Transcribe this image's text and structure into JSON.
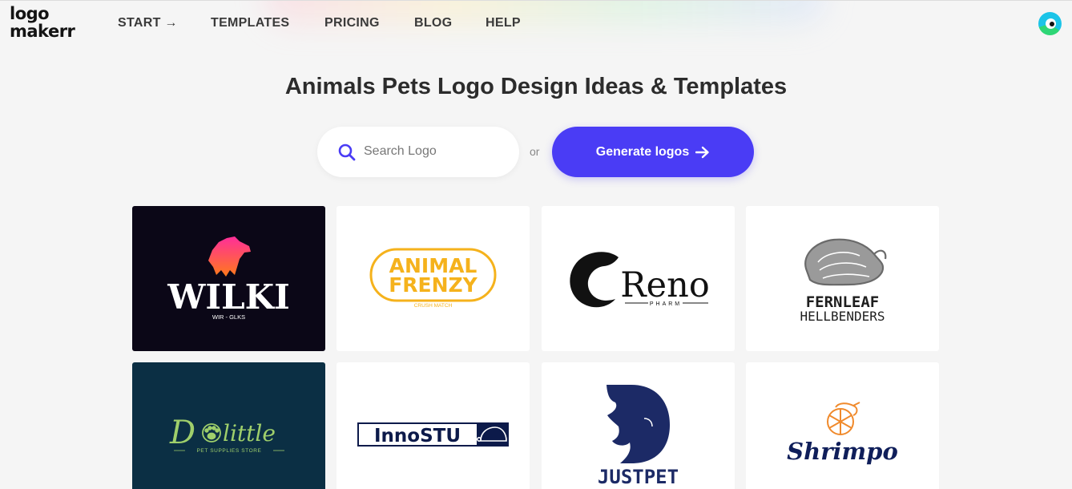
{
  "brand": {
    "line1": "logo",
    "line2": "makerr"
  },
  "nav": [
    {
      "label": "START →"
    },
    {
      "label": "TEMPLATES"
    },
    {
      "label": "PRICING"
    },
    {
      "label": "BLOG"
    },
    {
      "label": "HELP"
    }
  ],
  "page": {
    "title": "Animals Pets Logo Design Ideas & Templates"
  },
  "search": {
    "placeholder": "Search Logo",
    "value": ""
  },
  "or_text": "or",
  "generate": {
    "label": "Generate logos"
  },
  "logos": [
    {
      "name": "WILKI",
      "tagline": "WIR - GLKS",
      "bg": "#0b0717"
    },
    {
      "name": "ANIMAL",
      "name2": "FRENZY",
      "tagline": "CRUSH MATCH",
      "color": "#f5b21c"
    },
    {
      "name": "Reno",
      "tagline": "PHARM"
    },
    {
      "name": "FERNLEAF",
      "tagline": "HELLBENDERS"
    },
    {
      "name": "D",
      "name2": "little",
      "tagline": "PET SUPPLIES STORE",
      "bg": "#0b2f44",
      "color": "#9fcf6b"
    },
    {
      "name": "InnoSTU",
      "bg": "#0c1a4a"
    },
    {
      "name": "JUSTPET",
      "color": "#1c2a66"
    },
    {
      "name": "Shrimpo",
      "color": "#0f1e5a",
      "accent": "#f08a2c"
    }
  ],
  "colors": {
    "accent": "#4a3cf5",
    "page_bg": "#f5f5f5"
  }
}
